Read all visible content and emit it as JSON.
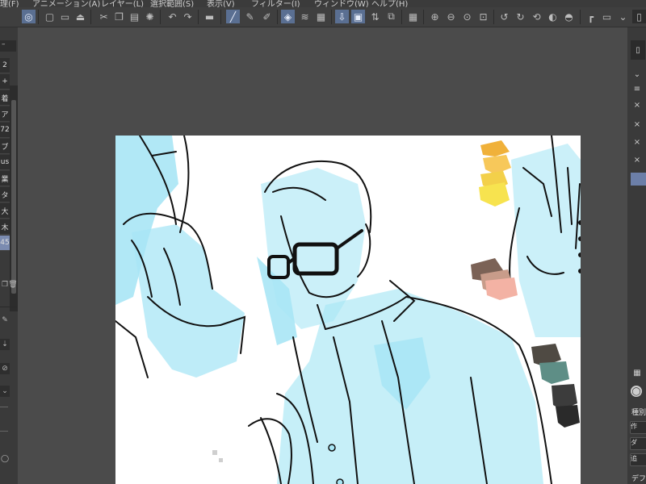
{
  "menubar": {
    "items": [
      {
        "label": "理(F)"
      },
      {
        "label": "アニメーション(A)"
      },
      {
        "label": "レイヤー(L)"
      },
      {
        "label": "選択範囲(S)"
      },
      {
        "label": "表示(V)"
      },
      {
        "label": "フィルター(I)"
      },
      {
        "label": "ウィンドウ(W)"
      },
      {
        "label": "ヘルプ(H)"
      }
    ]
  },
  "left_panel": {
    "items": [
      {
        "label": "2"
      },
      {
        "label": "+"
      },
      {
        "label": "着"
      },
      {
        "label": "ア"
      },
      {
        "label": "72"
      },
      {
        "label": "ブ"
      },
      {
        "label": "us"
      },
      {
        "label": "業"
      },
      {
        "label": "タ"
      },
      {
        "label": "大"
      },
      {
        "label": "木"
      },
      {
        "label": "45"
      }
    ]
  },
  "right_panel": {
    "labels": {
      "kind": "種別",
      "create": "作",
      "da": "ダ",
      "tsui": "追",
      "default": "デフ"
    }
  },
  "colors": {
    "background": "#4b4b4b",
    "accent": "#5a6f92",
    "sketch_blue": "#a8e6f5",
    "swatch_yellow": "#f7e34f",
    "swatch_orange": "#f0b13a",
    "swatch_pink": "#f3b2a4",
    "swatch_brown": "#7b6256",
    "swatch_teal": "#5e8e86",
    "swatch_dark": "#3c3c3c"
  }
}
